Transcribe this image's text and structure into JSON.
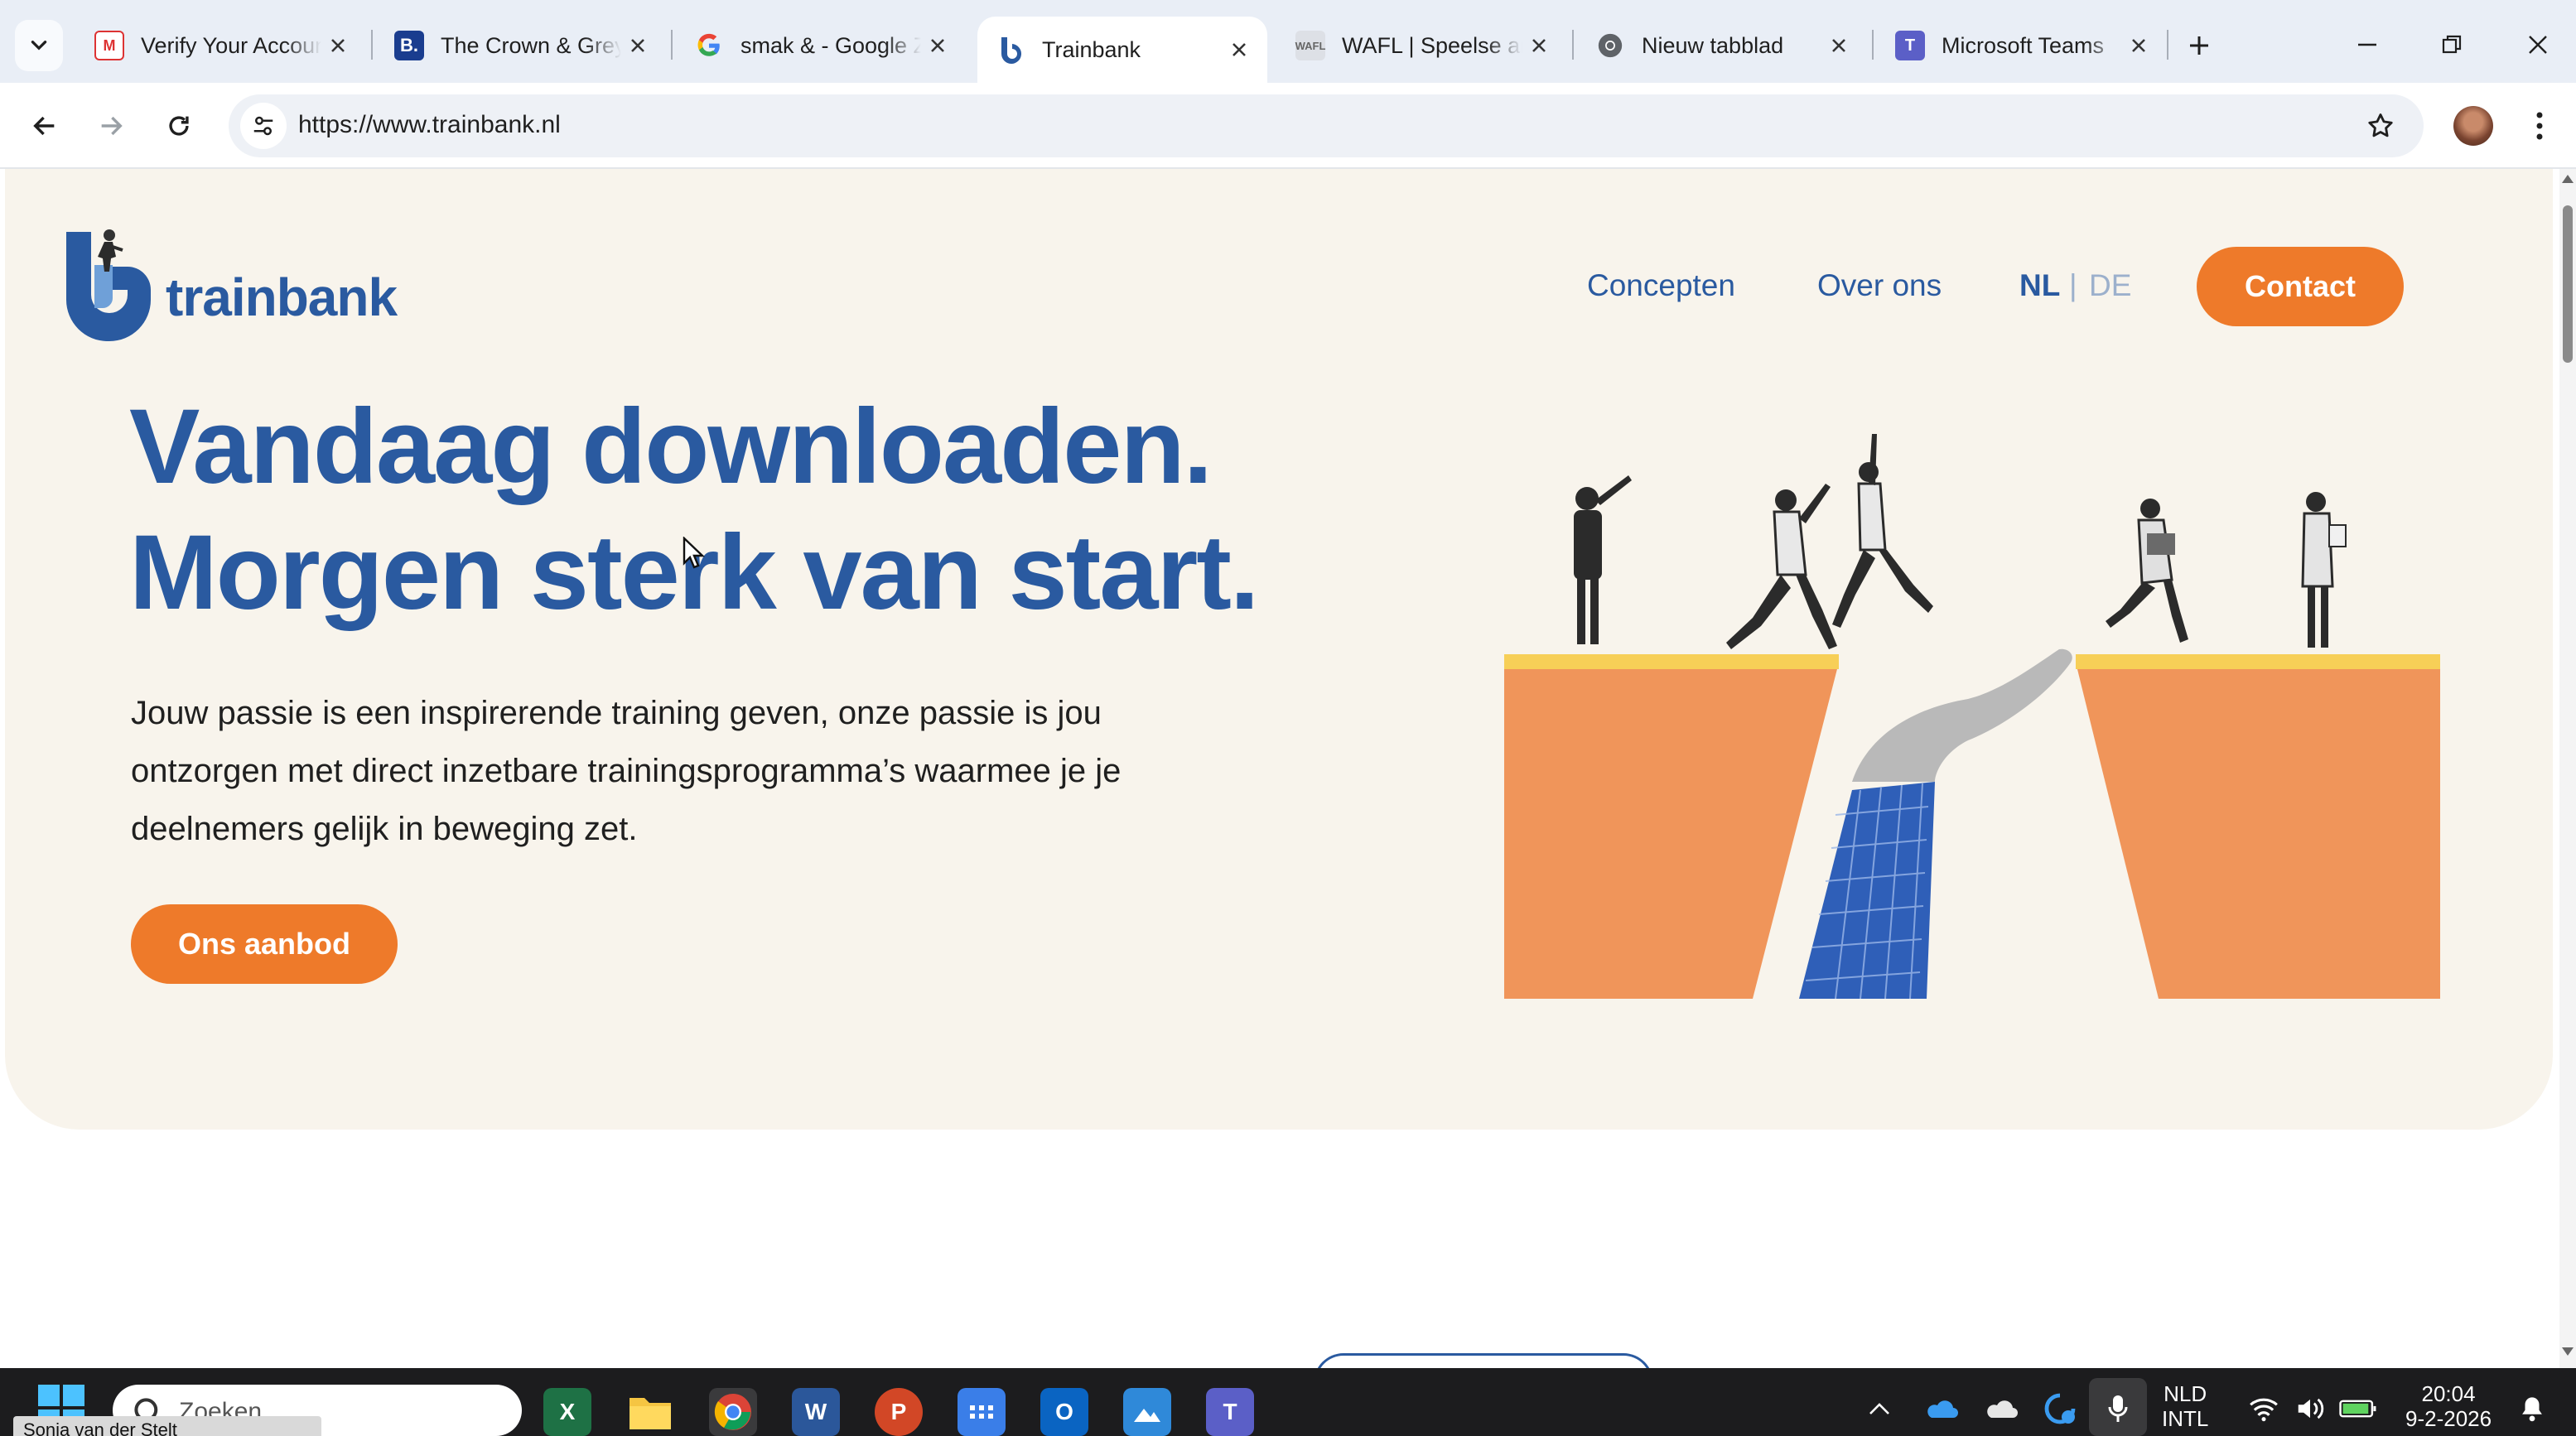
{
  "browser": {
    "tabs": [
      {
        "label": "Verify Your Account",
        "favicon": "gmail-icon",
        "active": false
      },
      {
        "label": "The Crown & Greyhound",
        "favicon": "booking-icon",
        "active": false
      },
      {
        "label": "smak & - Google Zoeken",
        "favicon": "google-icon",
        "active": false
      },
      {
        "label": "Trainbank",
        "favicon": "trainbank-icon",
        "active": true
      },
      {
        "label": "WAFL | Speelse analyse",
        "favicon": "wafl-icon",
        "active": false
      },
      {
        "label": "Nieuw tabblad",
        "favicon": "chrome-icon",
        "active": false
      },
      {
        "label": "Microsoft Teams",
        "favicon": "teams-icon",
        "active": false
      }
    ],
    "url": "https://www.trainbank.nl"
  },
  "site": {
    "brand": "trainbank",
    "nav": {
      "concepten": "Concepten",
      "over_ons": "Over ons",
      "lang_nl": "NL",
      "lang_sep": "|",
      "lang_de": "DE",
      "contact": "Contact"
    },
    "hero": {
      "headline_line1": "Vandaag downloaden.",
      "headline_line2": "Morgen sterk van start.",
      "intro": "Jouw passie is een inspirerende training geven, onze passie is jou ontzorgen met direct inzetbare trainingsprogramma’s waarmee je je deelnemers gelijk in beweging zet.",
      "cta": "Ons aanbod"
    },
    "colors": {
      "brand_blue": "#2a5aa0",
      "accent_orange": "#ee7a2a",
      "hero_bg": "#f8f4ec"
    }
  },
  "taskbar": {
    "search_placeholder": "Zoeken",
    "user_tag": "Sonja van der Stelt",
    "lang_line1": "NLD",
    "lang_line2": "INTL",
    "time": "20:04",
    "date": "9-2-2026"
  }
}
